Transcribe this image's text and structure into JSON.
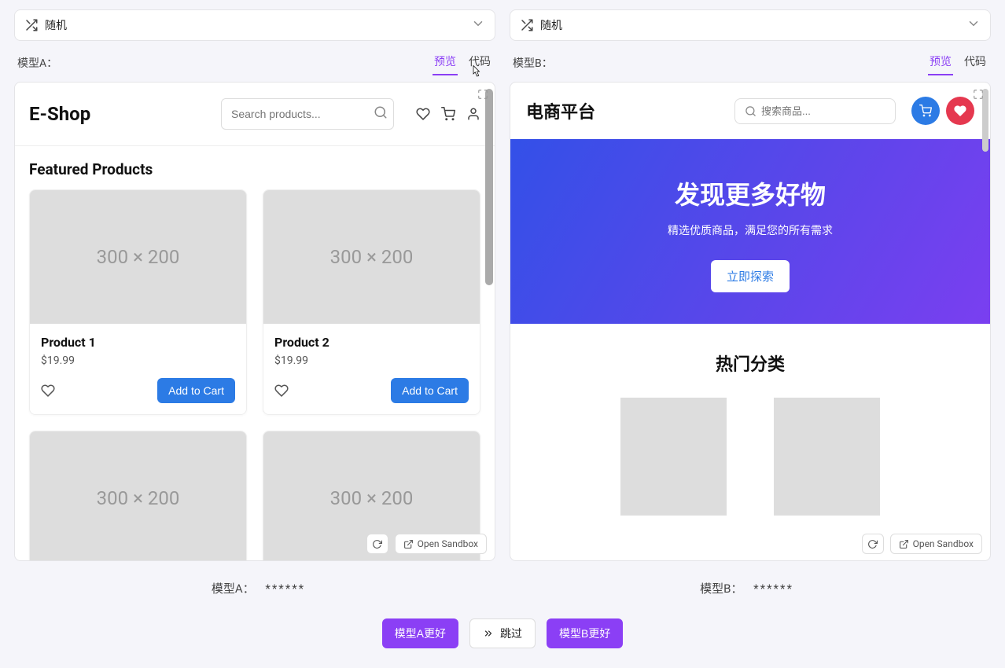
{
  "selector": {
    "label": "随机"
  },
  "panelA": {
    "model_label": "模型A：",
    "tabs": {
      "preview": "预览",
      "code": "代码"
    },
    "shop": {
      "logo": "E-Shop",
      "search_placeholder": "Search products...",
      "section_title": "Featured Products",
      "img_placeholder": "300 × 200",
      "products": [
        {
          "name": "Product 1",
          "price": "$19.99",
          "add": "Add to Cart"
        },
        {
          "name": "Product 2",
          "price": "$19.99",
          "add": "Add to Cart"
        }
      ]
    }
  },
  "panelB": {
    "model_label": "模型B：",
    "tabs": {
      "preview": "预览",
      "code": "代码"
    },
    "shop": {
      "logo": "电商平台",
      "search_placeholder": "搜索商品...",
      "hero": {
        "title": "发现更多好物",
        "subtitle": "精选优质商品，满足您的所有需求",
        "button": "立即探索"
      },
      "categories_title": "热门分类"
    }
  },
  "sandbox": {
    "open": "Open Sandbox"
  },
  "footer": {
    "labelA": "模型A：",
    "labelB": "模型B：",
    "stars": "******"
  },
  "votes": {
    "a_better": "模型A更好",
    "skip": "跳过",
    "b_better": "模型B更好"
  }
}
